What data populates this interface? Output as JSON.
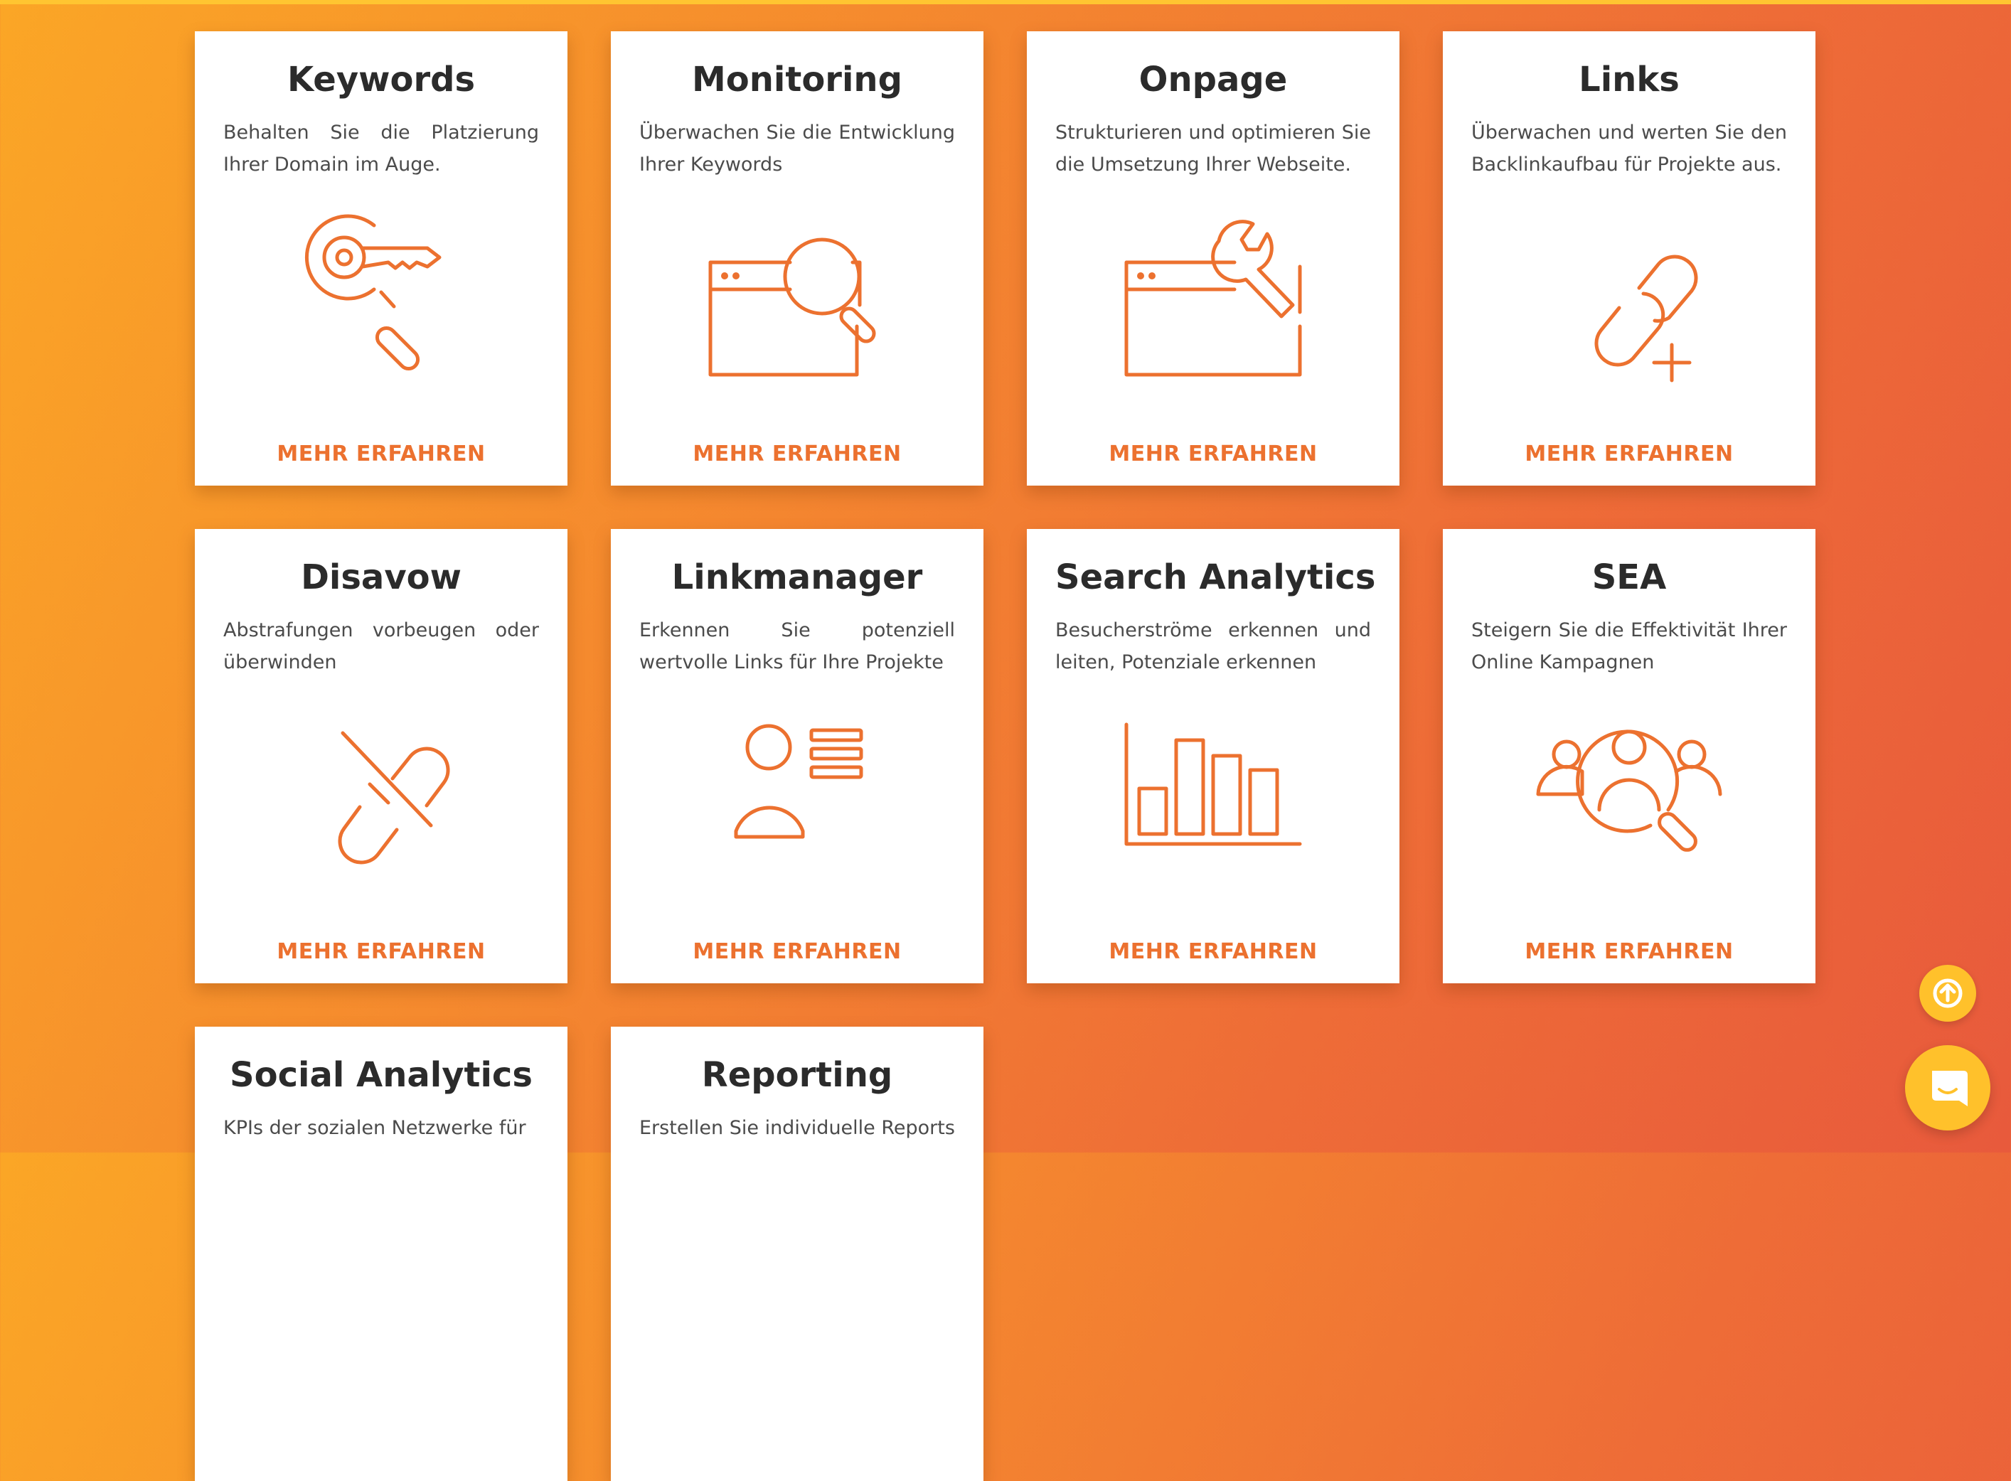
{
  "cards": [
    {
      "title": "Keywords",
      "description": "Behalten Sie die Platzierung Ihrer Domain im Auge.",
      "icon": "key-search-icon",
      "link_label": "MEHR ERFAHREN"
    },
    {
      "title": "Monitoring",
      "description": "Überwachen Sie die Entwicklung Ihrer Keywords",
      "icon": "browser-magnifier-icon",
      "link_label": "MEHR ERFAHREN"
    },
    {
      "title": "Onpage",
      "description": "Strukturieren und optimieren Sie die Umsetzung Ihrer Webseite.",
      "icon": "browser-wrench-icon",
      "link_label": "MEHR ERFAHREN"
    },
    {
      "title": "Links",
      "description": "Überwachen und werten Sie den Backlinkaufbau für Projekte aus.",
      "icon": "link-add-icon",
      "link_label": "MEHR ERFAHREN"
    },
    {
      "title": "Disavow",
      "description": "Abstrafungen vorbeugen oder überwinden",
      "icon": "broken-link-icon",
      "link_label": "MEHR ERFAHREN"
    },
    {
      "title": "Linkmanager",
      "description": "Erkennen Sie potenziell wertvolle Links für Ihre Projekte",
      "icon": "user-list-icon",
      "link_label": "MEHR ERFAHREN"
    },
    {
      "title": "Search Analytics",
      "description": "Besucherströme erkennen und leiten, Potenziale erkennen",
      "icon": "bar-chart-icon",
      "link_label": "MEHR ERFAHREN"
    },
    {
      "title": "SEA",
      "description": "Steigern Sie die Effektivität Ihrer Online Kampagnen",
      "icon": "audience-search-icon",
      "link_label": "MEHR ERFAHREN"
    },
    {
      "title": "Social Analytics",
      "description": "KPIs der sozialen Netzwerke für",
      "icon": "",
      "link_label": ""
    },
    {
      "title": "Reporting",
      "description": "Erstellen Sie individuelle Reports",
      "icon": "",
      "link_label": ""
    }
  ],
  "floating": {
    "scroll_top_icon": "arrow-up-circle-icon",
    "chat_icon": "chat-icon"
  },
  "colors": {
    "accent": "#ec712f",
    "gradient_start": "#fba626",
    "gradient_end": "#e85a3c",
    "button_yellow": "#ffc12b"
  }
}
